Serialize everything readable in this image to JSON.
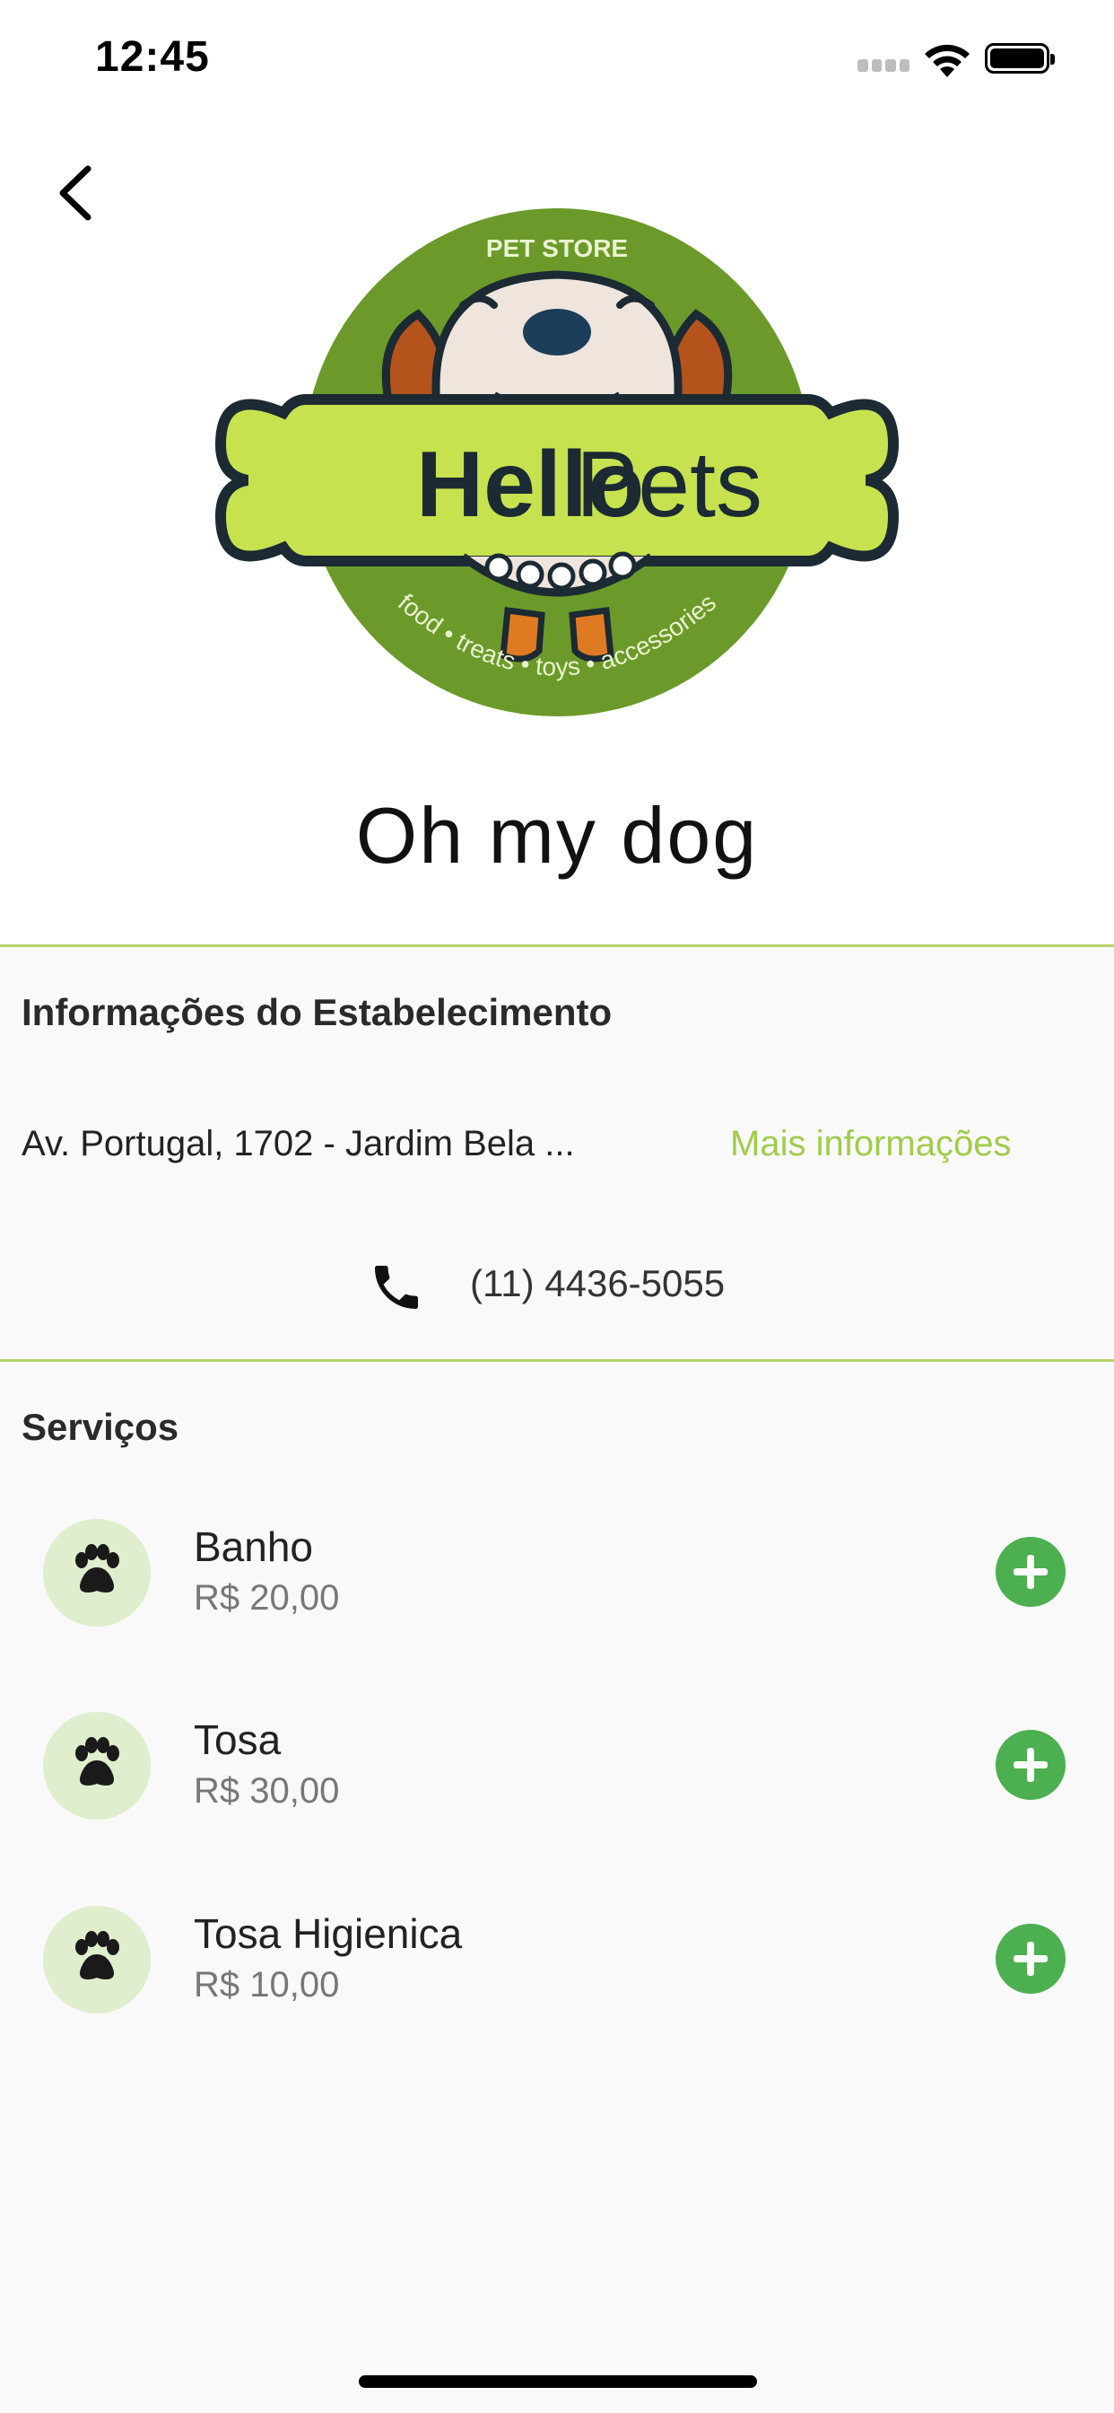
{
  "status_bar": {
    "time": "12:45"
  },
  "logo": {
    "top_text": "PET STORE",
    "brand_part1": "Hello",
    "brand_part2": "Pets",
    "tagline": "food • treats • toys • accessories",
    "colors": {
      "circle": "#6b9a2a",
      "bone": "#c6e34f",
      "outline": "#1b2a33"
    }
  },
  "store": {
    "name": "Oh my dog"
  },
  "info": {
    "title": "Informações do Estabelecimento",
    "address": "Av. Portugal, 1702 - Jardim Bela ...",
    "more_info_label": "Mais informações",
    "phone": "(11) 4436-5055"
  },
  "services": {
    "title": "Serviços",
    "items": [
      {
        "name": "Banho",
        "price": "R$ 20,00"
      },
      {
        "name": "Tosa",
        "price": "R$ 30,00"
      },
      {
        "name": "Tosa Higienica",
        "price": "R$ 10,00"
      }
    ]
  },
  "colors": {
    "accent": "#a0cc4a",
    "add_button": "#4caf50",
    "badge_bg": "#dfeecc"
  }
}
